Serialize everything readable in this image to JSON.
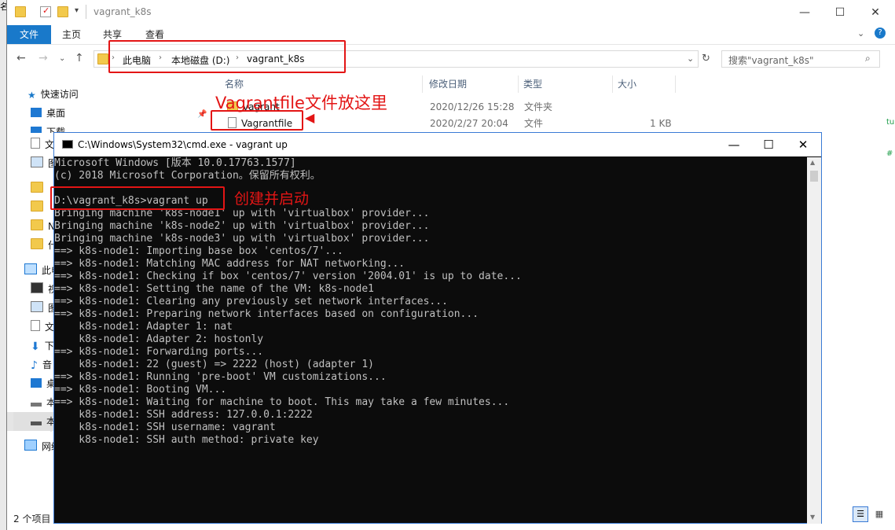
{
  "explorer": {
    "title": "vagrant_k8s",
    "left_stub": "名",
    "ribbon_tabs": [
      "文件",
      "主页",
      "共享",
      "查看"
    ],
    "breadcrumb": [
      "此电脑",
      "本地磁盘 (D:)",
      "vagrant_k8s"
    ],
    "search_placeholder": "搜索\"vagrant_k8s\"",
    "nav": {
      "quick_access": "快速访问",
      "items": [
        {
          "label": "桌面",
          "icon": "desktop-icon"
        },
        {
          "label": "下载",
          "icon": "download-icon"
        },
        {
          "label": "文",
          "icon": "document-icon"
        },
        {
          "label": "图",
          "icon": "picture-icon"
        },
        {
          "label": "",
          "icon": "folder-icon"
        },
        {
          "label": "",
          "icon": "folder-icon"
        },
        {
          "label": "N",
          "icon": "folder-icon"
        },
        {
          "label": "什",
          "icon": "folder-icon"
        }
      ],
      "this_pc": "此电",
      "pc_items": [
        {
          "label": "视",
          "icon": "video-icon"
        },
        {
          "label": "图",
          "icon": "picture-icon"
        },
        {
          "label": "文",
          "icon": "document-icon"
        },
        {
          "label": "下",
          "icon": "download-icon"
        },
        {
          "label": "音",
          "icon": "music-icon"
        },
        {
          "label": "桌",
          "icon": "desktop-icon"
        },
        {
          "label": "本",
          "icon": "drive-icon"
        },
        {
          "label": "本",
          "icon": "drive-icon"
        }
      ],
      "network": "网络"
    },
    "columns": [
      "名称",
      "修改日期",
      "类型",
      "大小"
    ],
    "files": [
      {
        "name": "vagrant",
        "date": "2020/12/26 15:28",
        "type": "文件夹",
        "size": ""
      },
      {
        "name": "Vagrantfile",
        "date": "2020/2/27 20:04",
        "type": "文件",
        "size": "1 KB"
      }
    ],
    "status": "2 个项目"
  },
  "annotations": {
    "vagrantfile_note": "Vagrantfile文件放这里",
    "create_note": "创建并启动"
  },
  "cmd": {
    "title": "C:\\Windows\\System32\\cmd.exe - vagrant  up",
    "lines": [
      "Microsoft Windows [版本 10.0.17763.1577]",
      "(c) 2018 Microsoft Corporation。保留所有权利。",
      "",
      "D:\\vagrant_k8s>vagrant up",
      "Bringing machine 'k8s-node1' up with 'virtualbox' provider...",
      "Bringing machine 'k8s-node2' up with 'virtualbox' provider...",
      "Bringing machine 'k8s-node3' up with 'virtualbox' provider...",
      "==> k8s-node1: Importing base box 'centos/7'...",
      "==> k8s-node1: Matching MAC address for NAT networking...",
      "==> k8s-node1: Checking if box 'centos/7' version '2004.01' is up to date...",
      "==> k8s-node1: Setting the name of the VM: k8s-node1",
      "==> k8s-node1: Clearing any previously set network interfaces...",
      "==> k8s-node1: Preparing network interfaces based on configuration...",
      "    k8s-node1: Adapter 1: nat",
      "    k8s-node1: Adapter 2: hostonly",
      "==> k8s-node1: Forwarding ports...",
      "    k8s-node1: 22 (guest) => 2222 (host) (adapter 1)",
      "==> k8s-node1: Running 'pre-boot' VM customizations...",
      "==> k8s-node1: Booting VM...",
      "==> k8s-node1: Waiting for machine to boot. This may take a few minutes...",
      "    k8s-node1: SSH address: 127.0.0.1:2222",
      "    k8s-node1: SSH username: vagrant",
      "    k8s-node1: SSH auth method: private key"
    ]
  },
  "colors": {
    "accent": "#1979ca",
    "annotation": "#e31515",
    "console_bg": "#0c0c0c",
    "console_fg": "#c0c0c0"
  }
}
